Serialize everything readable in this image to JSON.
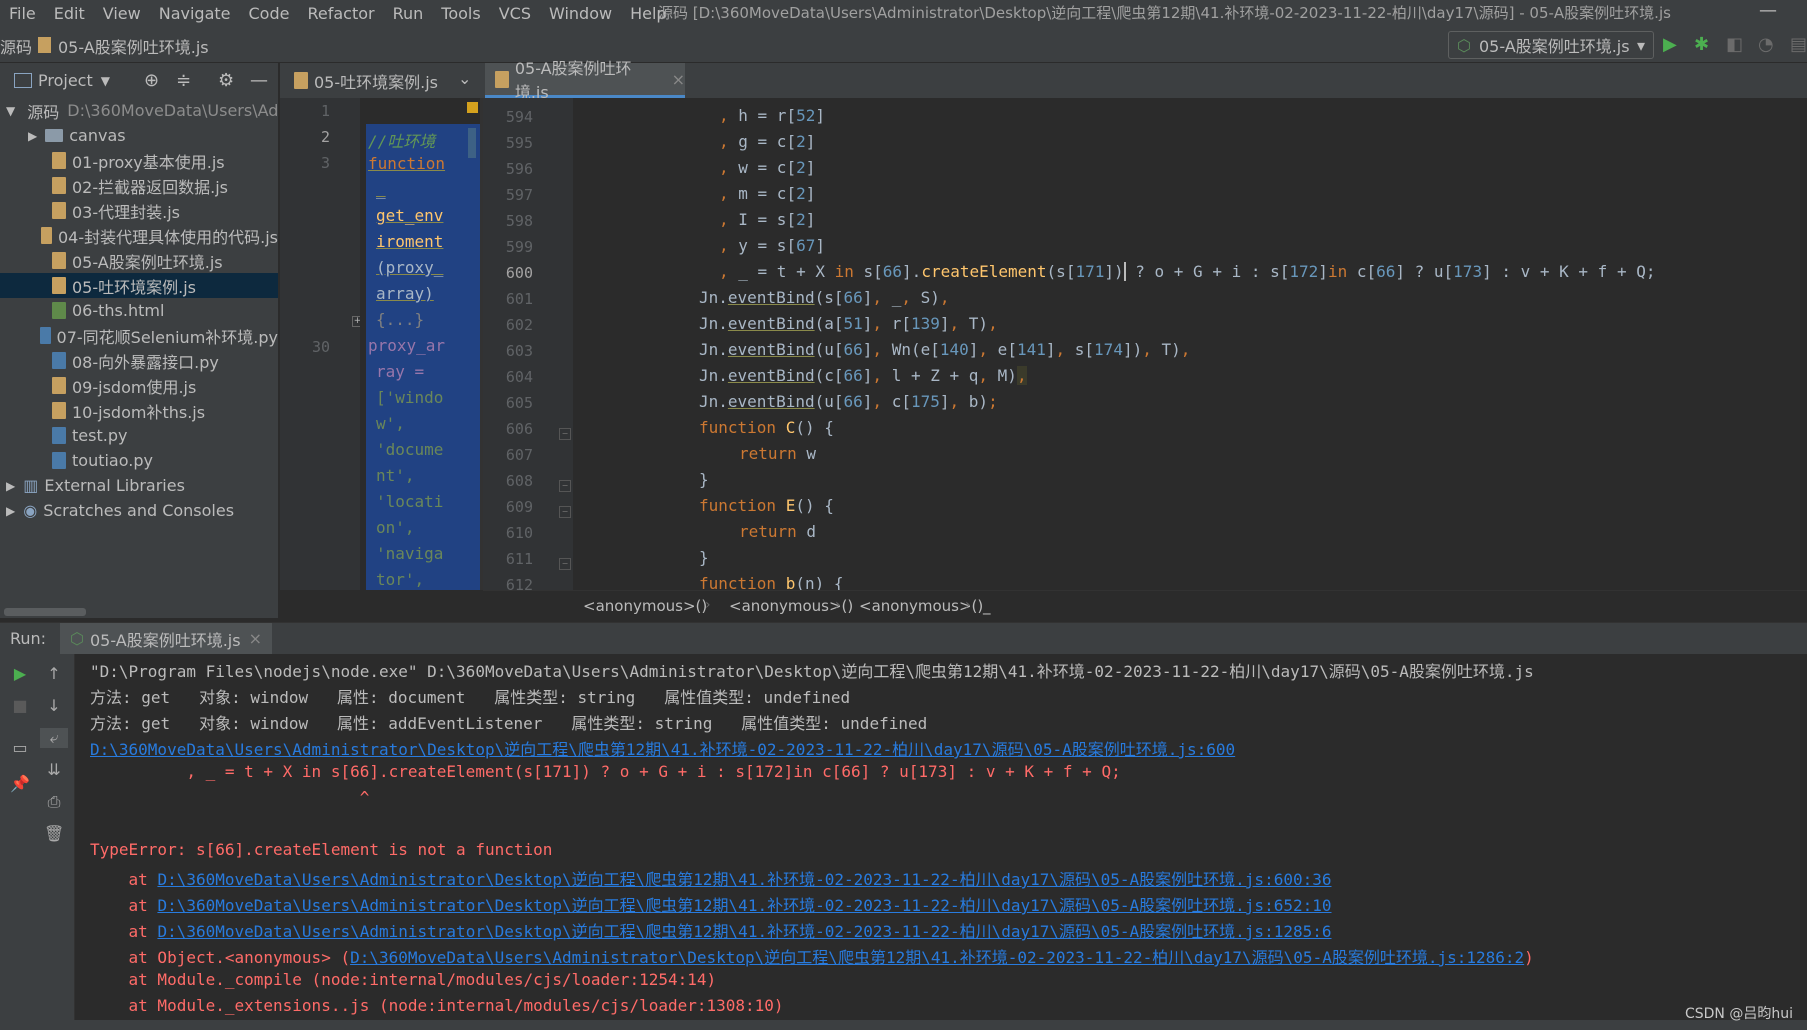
{
  "menubar": {
    "items": [
      "File",
      "Edit",
      "View",
      "Navigate",
      "Code",
      "Refactor",
      "Run",
      "Tools",
      "VCS",
      "Window",
      "Help"
    ],
    "title": "源码 [D:\\360MoveData\\Users\\Administrator\\Desktop\\逆向工程\\爬虫第12期\\41.补环境-02-2023-11-22-柏川\\day17\\源码] - 05-A股案例吐环境.js",
    "minimize": "—"
  },
  "navbar": {
    "crumb_root": "源码",
    "crumb_file": "05-A股案例吐环境.js",
    "run_config": "05-A股案例吐环境.js"
  },
  "project": {
    "header_label": "Project",
    "root_label": "源码",
    "root_path": "D:\\360MoveData\\Users\\Ad",
    "items": [
      {
        "name": "canvas",
        "type": "folder"
      },
      {
        "name": "01-proxy基本使用.js",
        "type": "js"
      },
      {
        "name": "02-拦截器返回数据.js",
        "type": "js"
      },
      {
        "name": "03-代理封装.js",
        "type": "js"
      },
      {
        "name": "04-封装代理具体使用的代码.js",
        "type": "js"
      },
      {
        "name": "05-A股案例吐环境.js",
        "type": "js"
      },
      {
        "name": "05-吐环境案例.js",
        "type": "js",
        "selected": true
      },
      {
        "name": "06-ths.html",
        "type": "html"
      },
      {
        "name": "07-同花顺Selenium补环境.py",
        "type": "py"
      },
      {
        "name": "08-向外暴露接口.py",
        "type": "py"
      },
      {
        "name": "09-jsdom使用.js",
        "type": "js"
      },
      {
        "name": "10-jsdom补ths.js",
        "type": "js"
      },
      {
        "name": "test.py",
        "type": "py"
      },
      {
        "name": "toutiao.py",
        "type": "py"
      }
    ],
    "external_libraries": "External Libraries",
    "scratches": "Scratches and Consoles"
  },
  "tabs": [
    {
      "label": "05-吐环境案例.js",
      "active": false
    },
    {
      "label": "05-A股案例吐环境.js",
      "active": true
    }
  ],
  "pane1": {
    "line_numbers": [
      "1",
      "2",
      "3",
      "30"
    ],
    "lines": [
      "//吐环境",
      "function",
      "_",
      "get_env",
      "iroment",
      "(proxy_",
      "array)",
      "{...}",
      "proxy_ar",
      "ray =",
      "['windo",
      "w',",
      "'docume",
      "nt',",
      "'locati",
      "on',",
      "'naviga",
      "tor',"
    ]
  },
  "editor": {
    "line_numbers": [
      "594",
      "595",
      "596",
      "597",
      "598",
      "599",
      "600",
      "601",
      "602",
      "603",
      "604",
      "605",
      "606",
      "607",
      "608",
      "609",
      "610",
      "611",
      "612"
    ],
    "current_line": "600"
  },
  "breadcrumbs": [
    "<anonymous>()",
    "<anonymous>()",
    "<anonymous>()",
    "_"
  ],
  "run": {
    "label": "Run:",
    "tab": "05-A股案例吐环境.js",
    "console": {
      "cmd": "\"D:\\Program Files\\nodejs\\node.exe\" D:\\360MoveData\\Users\\Administrator\\Desktop\\逆向工程\\爬虫第12期\\41.补环境-02-2023-11-22-柏川\\day17\\源码\\05-A股案例吐环境.js",
      "log1": "方法: get   对象: window   属性: document   属性类型: string   属性值类型: undefined",
      "log2": "方法: get   对象: window   属性: addEventListener   属性类型: string   属性值类型: undefined",
      "err_loc": "D:\\360MoveData\\Users\\Administrator\\Desktop\\逆向工程\\爬虫第12期\\41.补环境-02-2023-11-22-柏川\\day17\\源码\\05-A股案例吐环境.js:600",
      "err_src": "          , _ = t + X in s[66].createElement(s[171]) ? o + G + i : s[172]in c[66] ? u[173] : v + K + f + Q;",
      "err_caret": "                            ^",
      "err_msg": "TypeError: s[66].createElement is not a function",
      "at_prefix": "    at ",
      "stack1": "D:\\360MoveData\\Users\\Administrator\\Desktop\\逆向工程\\爬虫第12期\\41.补环境-02-2023-11-22-柏川\\day17\\源码\\05-A股案例吐环境.js:600:36",
      "stack2": "D:\\360MoveData\\Users\\Administrator\\Desktop\\逆向工程\\爬虫第12期\\41.补环境-02-2023-11-22-柏川\\day17\\源码\\05-A股案例吐环境.js:652:10",
      "stack3": "D:\\360MoveData\\Users\\Administrator\\Desktop\\逆向工程\\爬虫第12期\\41.补环境-02-2023-11-22-柏川\\day17\\源码\\05-A股案例吐环境.js:1285:6",
      "stack4_prefix": "    at Object.<anonymous> (",
      "stack4_link": "D:\\360MoveData\\Users\\Administrator\\Desktop\\逆向工程\\爬虫第12期\\41.补环境-02-2023-11-22-柏川\\day17\\源码\\05-A股案例吐环境.js:1286:2",
      "stack4_suffix": ")",
      "stack5": "    at Module._compile (node:internal/modules/cjs/loader:1254:14)",
      "stack6": "    at Module._extensions..js (node:internal/modules/cjs/loader:1308:10)"
    }
  },
  "watermark": "CSDN @吕昀hui"
}
